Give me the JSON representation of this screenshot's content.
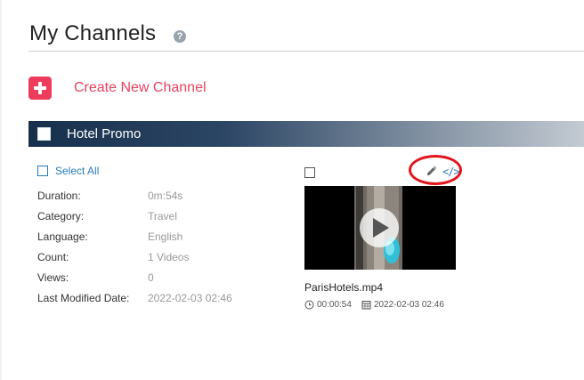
{
  "page": {
    "title": "My Channels",
    "help_icon": "question-circle-icon"
  },
  "actions": {
    "create_label": "Create New Channel",
    "create_icon": "plus-square-icon",
    "accent": "#ef3b5c"
  },
  "channel": {
    "name": "Hotel Promo",
    "select_all_label": "Select All",
    "details": [
      {
        "label": "Duration:",
        "value": "0m:54s"
      },
      {
        "label": "Category:",
        "value": "Travel"
      },
      {
        "label": "Language:",
        "value": "English"
      },
      {
        "label": "Count:",
        "value": "1 Videos"
      },
      {
        "label": "Views:",
        "value": "0"
      },
      {
        "label": "Last Modified Date:",
        "value": "2022-02-03 02:46"
      }
    ]
  },
  "video": {
    "filename": "ParisHotels.mp4",
    "duration": "00:00:54",
    "date": "2022-02-03 02:46",
    "edit_icon": "pencil-icon",
    "embed_icon": "code-icon",
    "embed_glyph": "</>"
  }
}
